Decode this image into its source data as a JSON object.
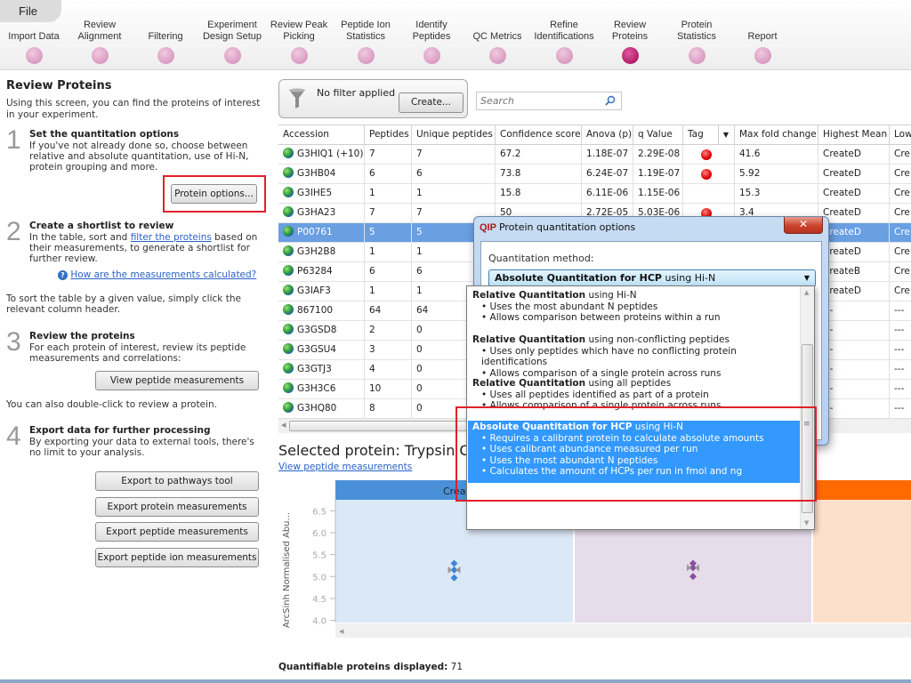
{
  "menu": {
    "file": "File"
  },
  "workflow": {
    "steps": [
      {
        "label": "Import Data",
        "active": false
      },
      {
        "label": "Review\nAlignment",
        "active": false
      },
      {
        "label": "Filtering",
        "active": false
      },
      {
        "label": "Experiment\nDesign Setup",
        "active": false
      },
      {
        "label": "Review Peak\nPicking",
        "active": false
      },
      {
        "label": "Peptide Ion\nStatistics",
        "active": false
      },
      {
        "label": "Identify\nPeptides",
        "active": false
      },
      {
        "label": "QC Metrics",
        "active": false
      },
      {
        "label": "Refine\nIdentifications",
        "active": false
      },
      {
        "label": "Review\nProteins",
        "active": true
      },
      {
        "label": "Protein\nStatistics",
        "active": false
      },
      {
        "label": "Report",
        "active": false
      }
    ]
  },
  "left": {
    "title": "Review Proteins",
    "intro": "Using this screen, you can find the proteins of interest in your experiment.",
    "s1": {
      "num": "1",
      "title": "Set the quantitation options",
      "text": "If you've not already done so, choose between relative and absolute quantitation, use of Hi-N, protein grouping and more.",
      "button": "Protein options..."
    },
    "s2": {
      "num": "2",
      "title": "Create a shortlist to review",
      "text_before": "In the table, sort and ",
      "link": "filter the proteins",
      "text_after": " based on their measurements, to generate a shortlist for further review.",
      "help_link": "How are the measurements calculated?",
      "sort_text": "To sort the table by a given value, simply click the relevant column header."
    },
    "s3": {
      "num": "3",
      "title": "Review the proteins",
      "text": "For each protein of interest, review its peptide measurements and correlations:",
      "button": "View peptide measurements",
      "dbl_text": "You can also double-click to review a protein."
    },
    "s4": {
      "num": "4",
      "title": "Export data for further processing",
      "text": "By exporting your data to external tools, there's no limit to your analysis.",
      "buttons": [
        "Export to pathways tool",
        "Export protein measurements",
        "Export peptide measurements",
        "Export peptide ion measurements"
      ]
    }
  },
  "filter": {
    "status": "No filter applied",
    "create": "Create..."
  },
  "search": {
    "placeholder": "Search"
  },
  "table": {
    "columns": [
      "Accession",
      "Peptides",
      "Unique peptides",
      "Confidence score",
      "Anova (p)",
      "q Value",
      "Tag",
      "Max fold change",
      "Highest Mean",
      "Lowest Mean"
    ],
    "rows": [
      {
        "accession": "G3HIQ1 (+10)",
        "peptides": "7",
        "unique": "7",
        "confidence": "67.2",
        "anova": "1.18E-07",
        "q": "2.29E-08",
        "tag": true,
        "fold": "41.6",
        "highest": "CreateD",
        "lowest": "Cre"
      },
      {
        "accession": "G3HB04",
        "peptides": "6",
        "unique": "6",
        "confidence": "73.8",
        "anova": "6.24E-07",
        "q": "1.19E-07",
        "tag": true,
        "fold": "5.92",
        "highest": "CreateD",
        "lowest": "Cre"
      },
      {
        "accession": "G3IHE5",
        "peptides": "1",
        "unique": "1",
        "confidence": "15.8",
        "anova": "6.11E-06",
        "q": "1.15E-06",
        "tag": false,
        "fold": "15.3",
        "highest": "CreateD",
        "lowest": "Cre"
      },
      {
        "accession": "G3HA23",
        "peptides": "7",
        "unique": "7",
        "confidence": "50",
        "anova": "2.72E-05",
        "q": "5.03E-06",
        "tag": true,
        "fold": "3.4",
        "highest": "CreateD",
        "lowest": "Cre"
      },
      {
        "accession": "P00761",
        "peptides": "5",
        "unique": "5",
        "confidence": "",
        "anova": "",
        "q": "",
        "tag": true,
        "fold": "",
        "highest": "CreateD",
        "lowest": "Cre",
        "selected": true
      },
      {
        "accession": "G3H2B8",
        "peptides": "1",
        "unique": "1",
        "confidence": "",
        "anova": "",
        "q": "",
        "tag": false,
        "fold": "",
        "highest": "CreateD",
        "lowest": "Cre"
      },
      {
        "accession": "P63284",
        "peptides": "6",
        "unique": "6",
        "confidence": "",
        "anova": "",
        "q": "",
        "tag": false,
        "fold": "",
        "highest": "CreateB",
        "lowest": "Cre"
      },
      {
        "accession": "G3IAF3",
        "peptides": "1",
        "unique": "1",
        "confidence": "",
        "anova": "",
        "q": "",
        "tag": false,
        "fold": "",
        "highest": "CreateD",
        "lowest": "Cre"
      },
      {
        "accession": "867100",
        "peptides": "64",
        "unique": "64",
        "confidence": "",
        "anova": "",
        "q": "",
        "tag": false,
        "fold": "",
        "highest": "---",
        "lowest": "---"
      },
      {
        "accession": "G3GSD8",
        "peptides": "2",
        "unique": "0",
        "confidence": "",
        "anova": "",
        "q": "",
        "tag": false,
        "fold": "",
        "highest": "---",
        "lowest": "---"
      },
      {
        "accession": "G3GSU4",
        "peptides": "3",
        "unique": "0",
        "confidence": "",
        "anova": "",
        "q": "",
        "tag": false,
        "fold": "",
        "highest": "---",
        "lowest": "---"
      },
      {
        "accession": "G3GTJ3",
        "peptides": "4",
        "unique": "0",
        "confidence": "",
        "anova": "",
        "q": "",
        "tag": false,
        "fold": "",
        "highest": "---",
        "lowest": "---"
      },
      {
        "accession": "G3H3C6",
        "peptides": "10",
        "unique": "0",
        "confidence": "",
        "anova": "",
        "q": "",
        "tag": false,
        "fold": "",
        "highest": "---",
        "lowest": "---"
      },
      {
        "accession": "G3HQ80",
        "peptides": "8",
        "unique": "0",
        "confidence": "",
        "anova": "",
        "q": "",
        "tag": false,
        "fold": "",
        "highest": "---",
        "lowest": "---"
      }
    ]
  },
  "selected_protein": {
    "title": "Selected protein: Trypsin C",
    "link": "View peptide measurements"
  },
  "chart_data": {
    "type": "scatter",
    "ylabel": "ArcSinh Normalised Abu...",
    "yticks": [
      "4.0",
      "4.5",
      "5.0",
      "5.5",
      "6.0",
      "6.5"
    ],
    "ylim": [
      3.95,
      6.75
    ],
    "groups": [
      {
        "name": "Create...",
        "header_color": "#4a90d9",
        "bg_color": "#dbe8f6",
        "point_color": "#3a86d8",
        "values": [
          5.3,
          5.15,
          4.97
        ]
      },
      {
        "name": "",
        "header_color": "#ffffff",
        "bg_color": "#e6dcea",
        "point_color": "#8a4fa0",
        "values": [
          5.3,
          5.2,
          5.0
        ]
      },
      {
        "name": "",
        "header_color": "#ff6a00",
        "bg_color": "#fde0cc",
        "point_color": "#ff6a00",
        "values": []
      }
    ]
  },
  "footer": {
    "count_label": "Quantifiable proteins displayed:",
    "count": "71"
  },
  "dialog": {
    "title": "Protein quantitation options",
    "method_label": "Quantitation method:",
    "selected_bold": "Absolute Quantitation for HCP",
    "selected_rest": " using Hi-N",
    "options": [
      {
        "bold": "Relative Quantitation",
        "rest": " using Hi-N",
        "bullets": [
          "Uses the most abundant N peptides",
          "Allows comparison between proteins within a run"
        ],
        "selected": false
      },
      {
        "bold": "Relative Quantitation",
        "rest": " using non-conflicting peptides",
        "bullets": [
          "Uses only peptides which have no conflicting protein identifications",
          "Allows comparison of a single protein across runs"
        ],
        "selected": false
      },
      {
        "bold": "Relative Quantitation",
        "rest": " using all peptides",
        "bullets": [
          "Uses all peptides identified as part of a protein",
          "Allows comparison of a single protein across runs"
        ],
        "selected": false
      },
      {
        "bold": "Absolute Quantitation for HCP",
        "rest": " using Hi-N",
        "bullets": [
          "Requires a calibrant protein to calculate absolute amounts",
          "Uses calibrant abundance measured per run",
          "Uses the most abundant N peptides",
          "Calculates the amount of HCPs per run in fmol and ng"
        ],
        "selected": true
      }
    ]
  }
}
